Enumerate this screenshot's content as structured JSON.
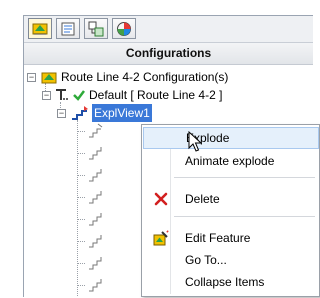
{
  "toolbar": {
    "tabs": [
      {
        "icon": "feature-manager-icon",
        "active": true
      },
      {
        "icon": "property-manager-icon",
        "active": false
      },
      {
        "icon": "configuration-manager-icon",
        "active": false
      },
      {
        "icon": "display-manager-icon",
        "active": false
      }
    ]
  },
  "panel": {
    "title": "Configurations"
  },
  "tree": {
    "root_label": "Route Line 4-2 Configuration(s)",
    "default_label": "Default [ Route Line 4-2 ]",
    "explode_label": "ExplView1",
    "step_count": 8
  },
  "context_menu": {
    "items": [
      {
        "label": "Explode",
        "icon": "",
        "highlighted": true
      },
      {
        "label": "Animate explode",
        "icon": ""
      },
      {
        "label": "Delete",
        "icon": "delete-x-icon"
      },
      {
        "label": "Edit Feature",
        "icon": "edit-feature-icon"
      },
      {
        "label": "Go To...",
        "icon": ""
      },
      {
        "label": "Collapse Items",
        "icon": ""
      }
    ]
  },
  "colors": {
    "selection": "#3a78d8",
    "delete_red": "#d21f1f",
    "hover": "#e5f0fb"
  }
}
